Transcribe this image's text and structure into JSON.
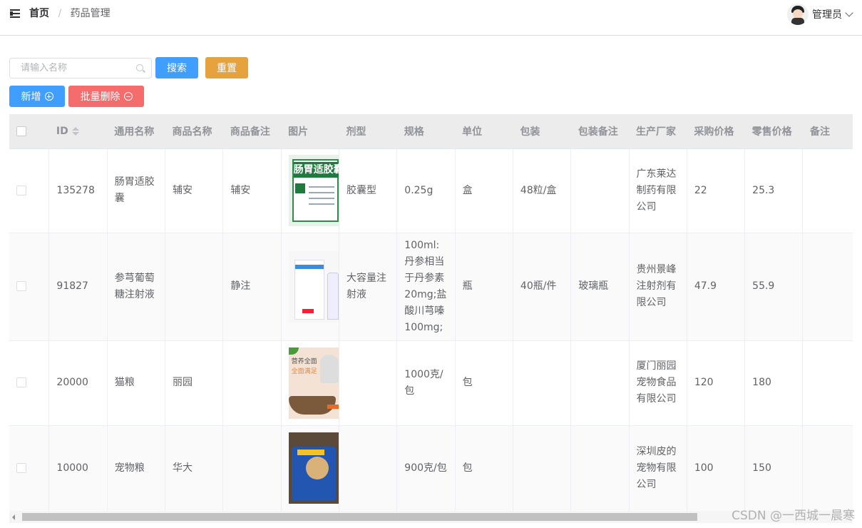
{
  "header": {
    "breadcrumb_home": "首页",
    "breadcrumb_separator": "/",
    "breadcrumb_current": "药品管理",
    "user_name": "管理员",
    "menu_icon": "menu-fold-icon",
    "dropdown_icon": "chevron-down-icon"
  },
  "toolbar": {
    "search_placeholder": "请输入名称",
    "search_label": "搜索",
    "reset_label": "重置",
    "add_label": "新增",
    "batch_delete_label": "批量删除"
  },
  "colors": {
    "primary": "#409eff",
    "warning": "#e6a23c",
    "danger": "#f56c6c"
  },
  "table": {
    "headers": [
      "ID",
      "通用名称",
      "商品名称",
      "商品备注",
      "图片",
      "剂型",
      "规格",
      "单位",
      "包装",
      "包装备注",
      "生产厂家",
      "采购价格",
      "零售价格",
      "备注"
    ],
    "rows": [
      {
        "id": "135278",
        "generic_name": "肠胃适胶囊",
        "product_name": "辅安",
        "product_note": "辅安",
        "image_text": "肠胃适胶囊",
        "dosage_form": "胶囊型",
        "spec": "0.25g",
        "unit": "盒",
        "packaging": "48粒/盒",
        "packaging_note": "",
        "manufacturer": "广东莱达制药有限公司",
        "purchase_price": "22",
        "retail_price": "25.3",
        "remark": ""
      },
      {
        "id": "91827",
        "generic_name": "参芎葡萄糖注射液",
        "product_name": "",
        "product_note": "静注",
        "image_text": "",
        "dosage_form": "大容量注射液",
        "spec": "100ml:丹参相当于丹参素20mg;盐酸川芎嗪100mg;",
        "unit": "瓶",
        "packaging": "40瓶/件",
        "packaging_note": "玻璃瓶",
        "manufacturer": "贵州景峰注射剂有限公司",
        "purchase_price": "47.9",
        "retail_price": "55.9",
        "remark": ""
      },
      {
        "id": "20000",
        "generic_name": "猫粮",
        "product_name": "丽园",
        "product_note": "",
        "image_text": "营养全面",
        "image_text2": "全面满足",
        "dosage_form": "",
        "spec": "1000克/包",
        "unit": "包",
        "packaging": "",
        "packaging_note": "",
        "manufacturer": "厦门丽园宠物食品有限公司",
        "purchase_price": "120",
        "retail_price": "180",
        "remark": ""
      },
      {
        "id": "10000",
        "generic_name": "宠物粮",
        "product_name": "华大",
        "product_note": "",
        "image_text": "",
        "dosage_form": "",
        "spec": "900克/包",
        "unit": "包",
        "packaging": "",
        "packaging_note": "",
        "manufacturer": "深圳皮的宠物有限公司",
        "purchase_price": "100",
        "retail_price": "150",
        "remark": ""
      }
    ]
  },
  "watermark": "CSDN @一西城一晨寒"
}
